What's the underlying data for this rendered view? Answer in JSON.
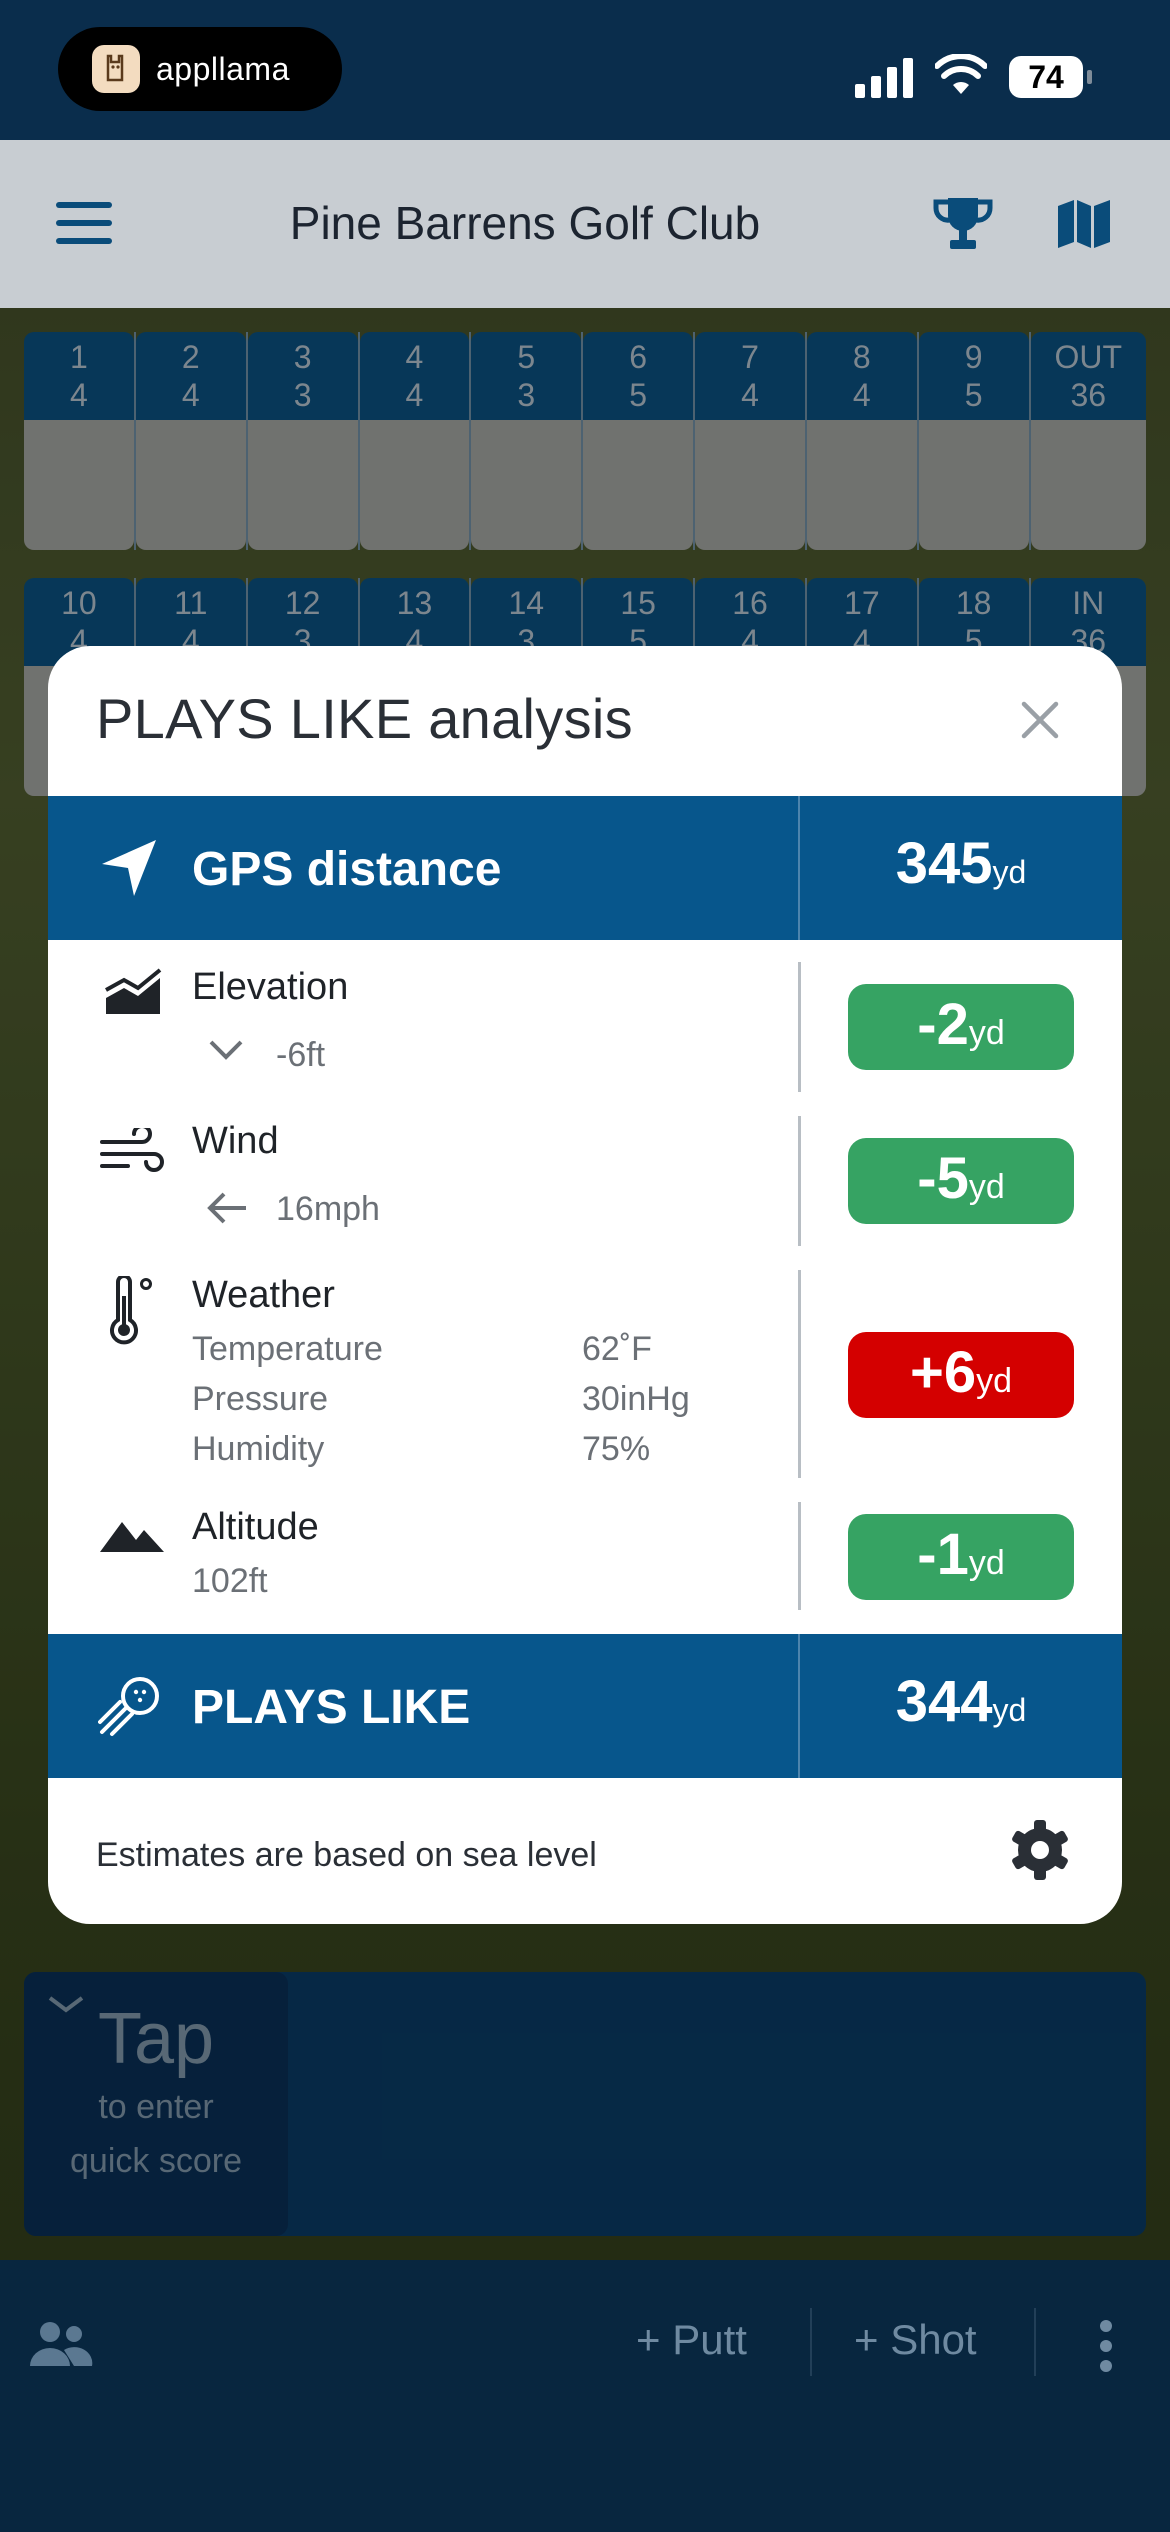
{
  "status_bar": {
    "app_badge": "appllama",
    "battery": "74"
  },
  "header": {
    "title": "Pine Barrens Golf Club"
  },
  "scorecard": {
    "front": [
      {
        "hole": "1",
        "par": "4"
      },
      {
        "hole": "2",
        "par": "4"
      },
      {
        "hole": "3",
        "par": "3"
      },
      {
        "hole": "4",
        "par": "4"
      },
      {
        "hole": "5",
        "par": "3"
      },
      {
        "hole": "6",
        "par": "5"
      },
      {
        "hole": "7",
        "par": "4"
      },
      {
        "hole": "8",
        "par": "4"
      },
      {
        "hole": "9",
        "par": "5"
      },
      {
        "hole": "OUT",
        "par": "36"
      }
    ],
    "back": [
      {
        "hole": "10",
        "par": "4"
      },
      {
        "hole": "11",
        "par": "4"
      },
      {
        "hole": "12",
        "par": "3"
      },
      {
        "hole": "13",
        "par": "4"
      },
      {
        "hole": "14",
        "par": "3"
      },
      {
        "hole": "15",
        "par": "5"
      },
      {
        "hole": "16",
        "par": "4"
      },
      {
        "hole": "17",
        "par": "4"
      },
      {
        "hole": "18",
        "par": "5"
      },
      {
        "hole": "IN",
        "par": "36"
      }
    ]
  },
  "modal": {
    "title": "PLAYS LIKE analysis",
    "gps": {
      "label": "GPS distance",
      "value": "345",
      "unit": "yd"
    },
    "elevation": {
      "label": "Elevation",
      "detail": "-6ft",
      "adjust": "-2",
      "unit": "yd",
      "color": "#36a363"
    },
    "wind": {
      "label": "Wind",
      "detail": "16mph",
      "adjust": "-5",
      "unit": "yd",
      "color": "#36a363"
    },
    "weather": {
      "label": "Weather",
      "rows": [
        {
          "name": "Temperature",
          "value": "62˚F"
        },
        {
          "name": "Pressure",
          "value": "30inHg"
        },
        {
          "name": "Humidity",
          "value": "75%"
        }
      ],
      "adjust": "+6",
      "unit": "yd",
      "color": "#d40000"
    },
    "altitude": {
      "label": "Altitude",
      "detail": "102ft",
      "adjust": "-1",
      "unit": "yd",
      "color": "#36a363"
    },
    "plays_like": {
      "label": "PLAYS LIKE",
      "value": "344",
      "unit": "yd"
    },
    "footer": "Estimates are based on sea level"
  },
  "quick_score": {
    "big": "Tap",
    "line1": "to enter",
    "line2": "quick score"
  },
  "bottom_bar": {
    "putt": "+ Putt",
    "shot": "+ Shot"
  },
  "colors": {
    "primary_blue": "#07568c",
    "positive": "#36a363",
    "negative": "#d40000"
  }
}
